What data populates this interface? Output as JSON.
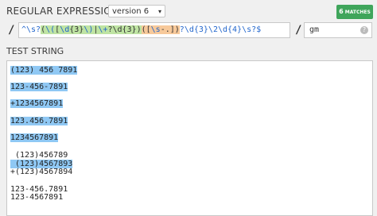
{
  "header": {
    "title": "REGULAR EXPRESSION —",
    "version_label": "version 6",
    "version_caret": "▾",
    "matches_count": "6",
    "matches_label": "MATCHES"
  },
  "regex": {
    "open_delim": "/",
    "close_delim": "/",
    "pattern_parts": [
      {
        "text": "^\\s?",
        "cls": "blue"
      },
      {
        "text": "(",
        "cls": "g1"
      },
      {
        "text": "\\(",
        "cls": "g1 esc"
      },
      {
        "text": "[",
        "cls": "g1"
      },
      {
        "text": "\\d",
        "cls": "g1 esc"
      },
      {
        "text": "{3}",
        "cls": "g1"
      },
      {
        "text": "\\)",
        "cls": "g1 esc"
      },
      {
        "text": "|",
        "cls": "g1"
      },
      {
        "text": "\\+",
        "cls": "g1 esc"
      },
      {
        "text": "?\\d{3}",
        "cls": "g1"
      },
      {
        "text": ")",
        "cls": "g1"
      },
      {
        "text": "(",
        "cls": "g2"
      },
      {
        "text": "[",
        "cls": "g2"
      },
      {
        "text": "\\s",
        "cls": "g2 esc"
      },
      {
        "text": "-.",
        "cls": "g2"
      },
      {
        "text": "])",
        "cls": "g2"
      },
      {
        "text": "?\\d{3}\\2\\d{4}\\s?$",
        "cls": "blue"
      }
    ],
    "flags": "gm",
    "help_icon": "?"
  },
  "test": {
    "label": "TEST STRING",
    "lines": [
      {
        "text": "(123) 456 7891",
        "match": true
      },
      {
        "text": "123-456-7891",
        "match": true
      },
      {
        "text": "+1234567891",
        "match": true
      },
      {
        "text": "123.456.7891",
        "match": true
      },
      {
        "text": "1234567891",
        "match": true
      },
      {
        "text": " (123)456789",
        "match": false
      },
      {
        "text": " (123)4567893",
        "match": true
      },
      {
        "text": "+(123)4567894",
        "match": false
      },
      {
        "text": "123-456.7891",
        "match": false
      },
      {
        "text": "123-4567891",
        "match": false
      }
    ]
  }
}
